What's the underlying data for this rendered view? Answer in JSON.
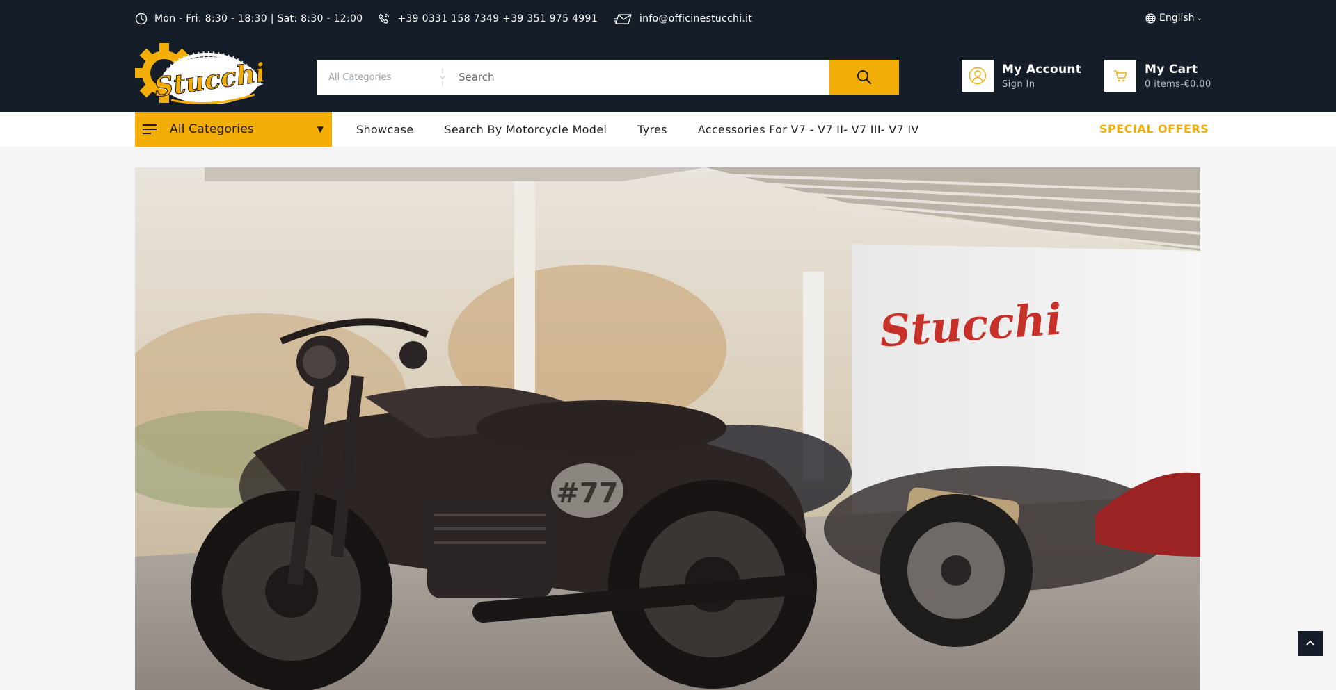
{
  "topbar": {
    "hours": "Mon - Fri: 8:30 - 18:30 | Sat: 8:30 - 12:00",
    "phones": "+39 0331 158 7349  +39 351 975 4991",
    "email": "info@officinestucchi.it",
    "language": "English"
  },
  "logo": {
    "text": "Stucchi"
  },
  "search": {
    "category_placeholder": "All Categories",
    "placeholder": "Search"
  },
  "account": {
    "title": "My Account",
    "subtitle": "Sign In"
  },
  "cart": {
    "title": "My Cart",
    "subtitle": "0 items-€0.00"
  },
  "nav": {
    "all_categories": "All Categories",
    "items": [
      "Showcase",
      "Search By Motorcycle Model",
      "Tyres",
      "Accessories For V7 - V7 II- V7 III- V7 IV"
    ],
    "special": "SPECIAL OFFERS"
  },
  "hero": {
    "wall_text": "Stucchi",
    "plate_text": "#77"
  },
  "icons": {
    "clock": "clock-icon",
    "phone": "phone-icon",
    "email": "envelope-icon",
    "globe": "globe-icon",
    "search": "search-icon",
    "user": "user-icon",
    "cart": "cart-icon",
    "menu": "menu-icon",
    "scroll_top": "chevron-up-icon"
  },
  "colors": {
    "header_bg": "#151d28",
    "accent": "#f4ae08",
    "page_bg": "#f5f5f5"
  }
}
